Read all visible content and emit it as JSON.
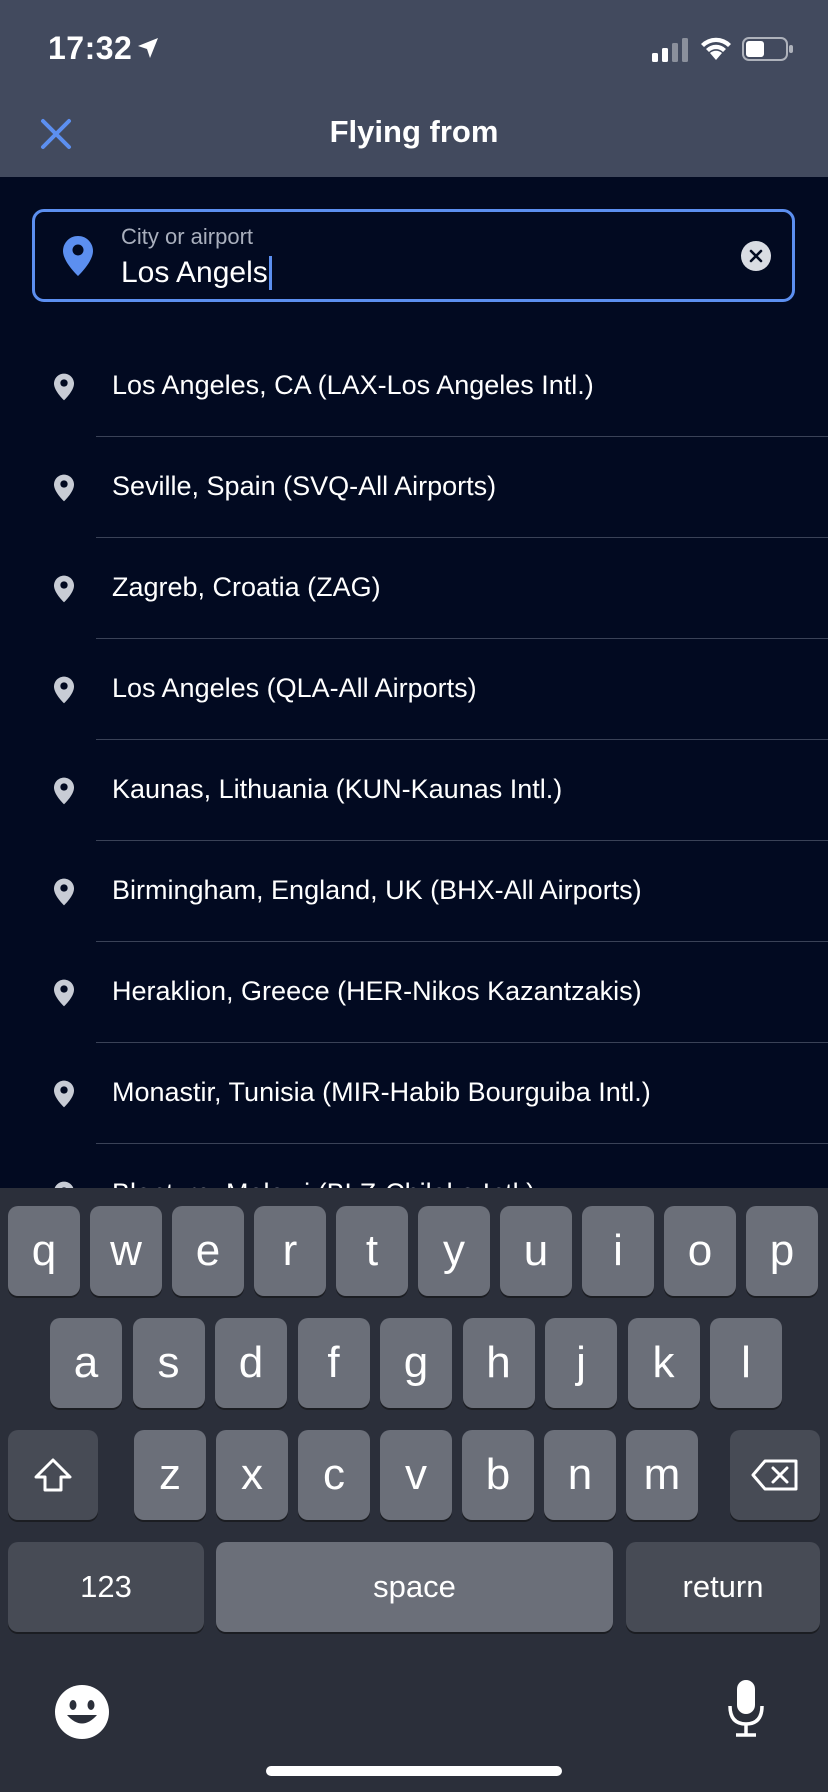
{
  "status": {
    "time": "17:32"
  },
  "nav": {
    "title": "Flying from"
  },
  "search": {
    "label": "City or airport",
    "value": "Los Angels"
  },
  "results": [
    "Los Angeles, CA (LAX-Los Angeles Intl.)",
    "Seville, Spain (SVQ-All Airports)",
    "Zagreb, Croatia (ZAG)",
    "Los Angeles (QLA-All Airports)",
    "Kaunas, Lithuania (KUN-Kaunas Intl.)",
    "Birmingham, England, UK (BHX-All Airports)",
    "Heraklion, Greece (HER-Nikos Kazantzakis)",
    "Monastir, Tunisia (MIR-Habib Bourguiba Intl.)",
    "Blantyre, Malawi (BLZ-Chileka Intl.)"
  ],
  "keyboard": {
    "row1": [
      "q",
      "w",
      "e",
      "r",
      "t",
      "y",
      "u",
      "i",
      "o",
      "p"
    ],
    "row2": [
      "a",
      "s",
      "d",
      "f",
      "g",
      "h",
      "j",
      "k",
      "l"
    ],
    "row3": [
      "z",
      "x",
      "c",
      "v",
      "b",
      "n",
      "m"
    ],
    "numbers_label": "123",
    "space_label": "space",
    "return_label": "return"
  },
  "colors": {
    "accent": "#5c8ff0",
    "header_bg": "#424a5e",
    "page_bg": "#020a21"
  }
}
